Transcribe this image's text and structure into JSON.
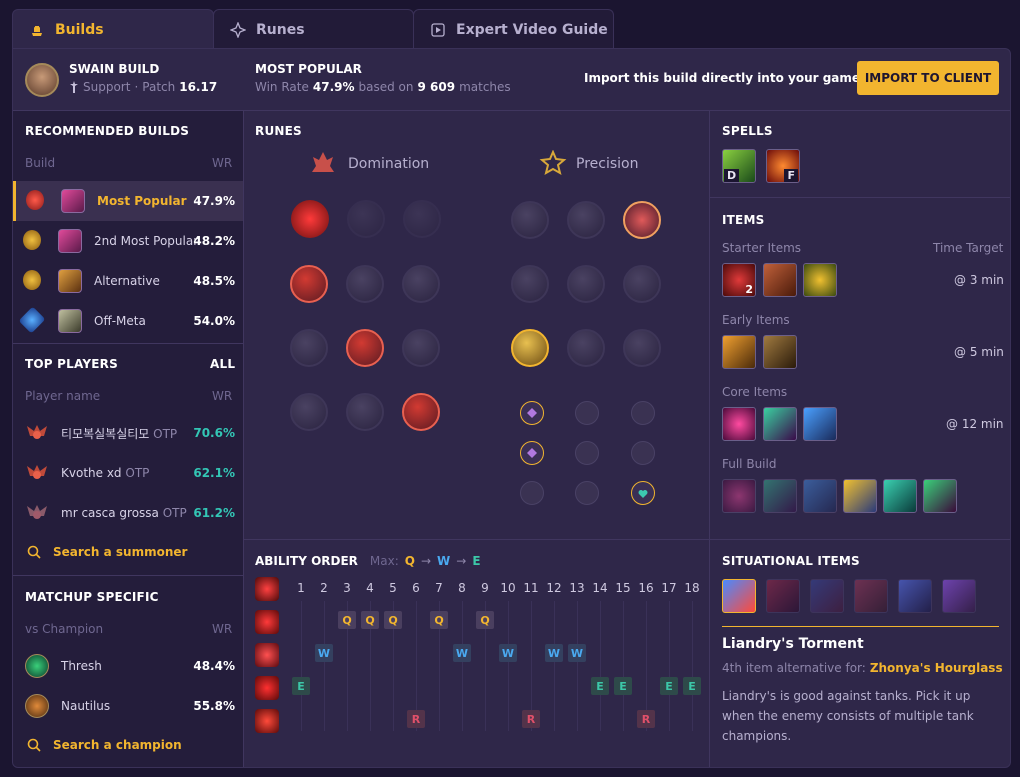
{
  "tabs": [
    {
      "label": "Builds"
    },
    {
      "label": "Runes"
    },
    {
      "label": "Expert Video Guide"
    }
  ],
  "header": {
    "title": "SWAIN BUILD",
    "role": "Support",
    "patch_label": "Patch",
    "patch": "16.17",
    "popular_title": "MOST POPULAR",
    "winrate_prefix": "Win Rate",
    "winrate": "47.9%",
    "based_on": "based on",
    "matches": "9 609",
    "matches_suffix": "matches",
    "import_text": "Import this build directly into your game client:",
    "import_button": "IMPORT TO CLIENT"
  },
  "builds": {
    "title": "RECOMMENDED BUILDS",
    "col_build": "Build",
    "col_wr": "WR",
    "items": [
      {
        "label": "Most Popular",
        "wr": "47.9%"
      },
      {
        "label": "2nd Most Popular",
        "wr": "48.2%"
      },
      {
        "label": "Alternative",
        "wr": "48.5%"
      },
      {
        "label": "Off-Meta",
        "wr": "54.0%"
      }
    ]
  },
  "players": {
    "title": "TOP PLAYERS",
    "all": "ALL",
    "col_name": "Player name",
    "col_wr": "WR",
    "items": [
      {
        "name": "티모복실복실티모",
        "tag": "OTP",
        "wr": "70.6%"
      },
      {
        "name": "Kvothe xd",
        "tag": "OTP",
        "wr": "62.1%"
      },
      {
        "name": "mr casca grossa",
        "tag": "OTP",
        "wr": "61.2%"
      }
    ],
    "search": "Search a summoner"
  },
  "matchups": {
    "title": "MATCHUP SPECIFIC",
    "col_vs": "vs Champion",
    "col_wr": "WR",
    "items": [
      {
        "name": "Thresh",
        "wr": "48.4%"
      },
      {
        "name": "Nautilus",
        "wr": "55.8%"
      }
    ],
    "search": "Search a champion"
  },
  "runes": {
    "title": "RUNES",
    "primary": "Domination",
    "secondary": "Precision"
  },
  "spells": {
    "title": "SPELLS",
    "d": "D",
    "f": "F"
  },
  "items": {
    "title": "ITEMS",
    "starter": "Starter Items",
    "time_target": "Time Target",
    "starter_time": "@ 3 min",
    "starter_count": "2",
    "early": "Early Items",
    "early_time": "@ 5 min",
    "core": "Core Items",
    "core_time": "@ 12 min",
    "full": "Full Build"
  },
  "ability": {
    "title": "ABILITY ORDER",
    "max_label": "Max:",
    "q": "Q",
    "w": "W",
    "e": "E",
    "arrow": "→",
    "levels": [
      "1",
      "2",
      "3",
      "4",
      "5",
      "6",
      "7",
      "8",
      "9",
      "10",
      "11",
      "12",
      "13",
      "14",
      "15",
      "16",
      "17",
      "18"
    ],
    "rows": [
      {
        "key": "Q",
        "levels": [
          3,
          4,
          5,
          7,
          9
        ]
      },
      {
        "key": "W",
        "levels": [
          2,
          8,
          10,
          12,
          13
        ]
      },
      {
        "key": "E",
        "levels": [
          1,
          14,
          15,
          17,
          18
        ]
      },
      {
        "key": "R",
        "levels": [
          6,
          11,
          16
        ]
      }
    ]
  },
  "situational": {
    "title": "SITUATIONAL ITEMS",
    "item_name": "Liandry's Torment",
    "alt_text": "4th item alternative for:",
    "alt_item": "Zhonya's Hourglass",
    "desc": "Liandry's is good against tanks. Pick it up when the enemy consists of multiple tank champions."
  }
}
